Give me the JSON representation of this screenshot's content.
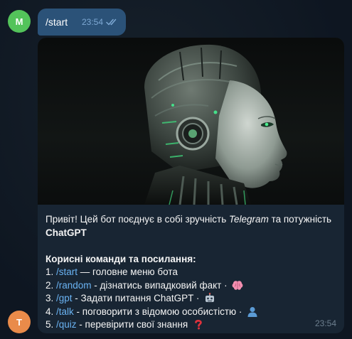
{
  "out_message": {
    "avatar_letter": "M",
    "text": "/start",
    "time": "23:54"
  },
  "bot_message": {
    "avatar_letter": "T",
    "time": "23:54",
    "intro_pre": "Привіт! Цей бот поєднує в собі зручність ",
    "intro_italic": "Telegram",
    "intro_post": " та потужність",
    "intro_bold": "ChatGPT",
    "heading": "Корисні команди та посилання:",
    "commands": [
      {
        "num": "1. ",
        "cmd": "/start",
        "desc": " — головне меню бота",
        "emoji": ""
      },
      {
        "num": "2. ",
        "cmd": "/random",
        "desc": " - дізнатись випадковий факт · ",
        "emoji": "brain-icon"
      },
      {
        "num": "3. ",
        "cmd": "/gpt",
        "desc": " - Задати питання ChatGPT · ",
        "emoji": "robot-icon"
      },
      {
        "num": "4. ",
        "cmd": "/talk",
        "desc": " - поговорити з відомою особистістю · ",
        "emoji": "person-silhouette-icon"
      },
      {
        "num": "5. ",
        "cmd": "/quiz",
        "desc": " - перевірити свої знання ",
        "emoji": "question-mark-icon"
      }
    ]
  },
  "colors": {
    "background": "#0e1621",
    "outgoing_bubble": "#2b5278",
    "incoming_bubble": "#182533",
    "command_link": "#6ab3f3"
  }
}
